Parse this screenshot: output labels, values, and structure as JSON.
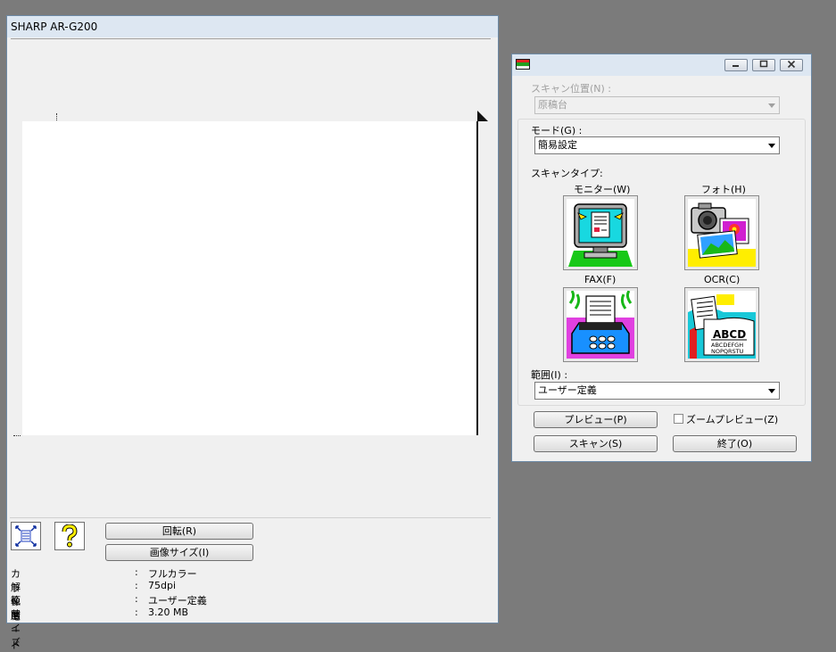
{
  "preview_window": {
    "title": "SHARP AR-G200",
    "rotate_label": "回転(R)",
    "image_size_label": "画像サイズ(I)",
    "info": [
      {
        "key": "カラーモード",
        "sep": ":",
        "value": "フルカラー"
      },
      {
        "key": "解像度",
        "sep": ":",
        "value": "75dpi"
      },
      {
        "key": "範囲",
        "sep": ":",
        "value": "ユーザー定義"
      },
      {
        "key": "サイズ",
        "sep": ":",
        "value": "3.20 MB"
      }
    ]
  },
  "dialog": {
    "icon": "twain-icon",
    "scan_position_label": "スキャン位置(N) :",
    "scan_position_value": "原稿台",
    "mode_label": "モード(G) :",
    "mode_value": "簡易設定",
    "scan_type_label": "スキャンタイプ:",
    "scan_types": [
      {
        "label": "モニター(W)",
        "icon": "monitor-icon"
      },
      {
        "label": "フォト(H)",
        "icon": "photo-icon"
      },
      {
        "label": "FAX(F)",
        "icon": "fax-icon"
      },
      {
        "label": "OCR(C)",
        "icon": "ocr-icon"
      }
    ],
    "ocr_sample_big": "ABCD",
    "ocr_sample_line1": "ABCDEFGH",
    "ocr_sample_line2": "NOPQRSTU",
    "range_label": "範囲(I) :",
    "range_value": "ユーザー定義",
    "preview_label": "プレビュー(P)",
    "zoom_preview_label": "ズームプレビュー(Z)",
    "scan_label": "スキャン(S)",
    "exit_label": "終了(O)"
  },
  "colors": {
    "desktop": "#7b7b7b",
    "window_bg": "#f0f0f0",
    "titlebar": "#dde7f2"
  }
}
